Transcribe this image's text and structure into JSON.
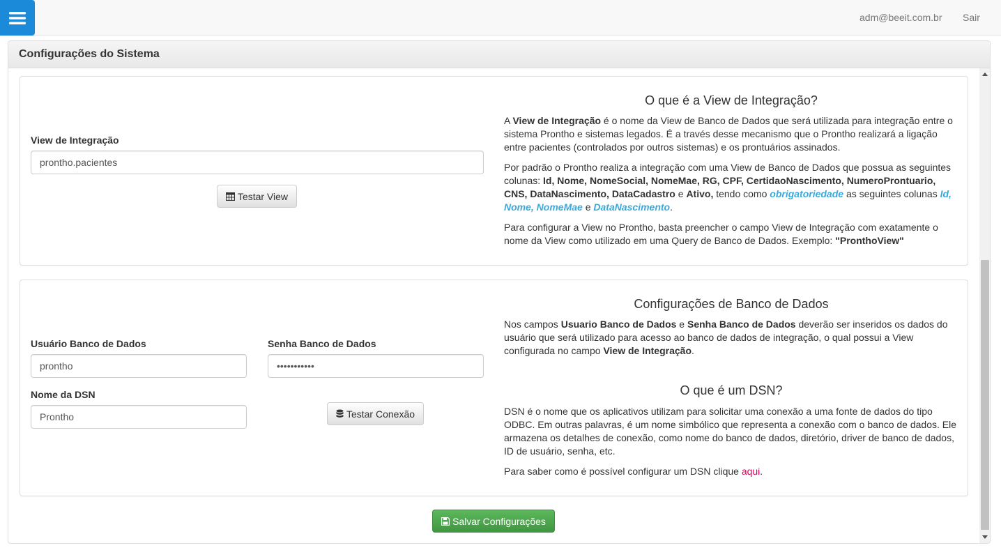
{
  "header": {
    "user_email": "adm@beeit.com.br",
    "logout_label": "Sair",
    "menu_icon": "hamburger-menu-icon"
  },
  "panel": {
    "title": "Configurações do Sistema"
  },
  "view_section": {
    "field_label": "View de Integração",
    "field_value": "prontho.pacientes",
    "test_button_label": "Testar View",
    "test_button_icon": "table-icon",
    "info_title": "O que é a View de Integração?",
    "para1": {
      "t1": "A ",
      "b1": "View de Integração",
      "t2": " é o nome da View de Banco de Dados que será utilizada para integração entre o sistema Prontho e sistemas legados. É a través desse mecanismo que o Prontho realizará a ligação entre pacientes (controlados por outros sistemas) e os prontuários assinados."
    },
    "para2": {
      "t1": "Por padrão o Prontho realiza a integração com uma View de Banco de Dados que possua as seguintes colunas: ",
      "b1": "Id, Nome, NomeSocial, NomeMae, RG, CPF, CertidaoNascimento, NumeroProntuario, CNS, DataNascimento, DataCadastro",
      "t2": " e ",
      "b2": "Ativo,",
      "t3": " tendo como ",
      "h1": "obrigatoriedade",
      "t4": " as seguintes colunas ",
      "h2": "Id, Nome, NomeMae",
      "t5": " e ",
      "h3": "DataNascimento",
      "t6": "."
    },
    "para3": {
      "t1": "Para configurar a View no Prontho, basta preencher o campo View de Integração com exatamente o nome da View como utilizado em uma Query de Banco de Dados. Exemplo: ",
      "b1": "\"PronthoView\""
    }
  },
  "db_section": {
    "user_label": "Usuário Banco de Dados",
    "user_value": "prontho",
    "password_label": "Senha Banco de Dados",
    "password_value": "•••••••••••",
    "dsn_label": "Nome da DSN",
    "dsn_value": "Prontho",
    "test_button_label": "Testar Conexão",
    "test_button_icon": "database-icon",
    "info_title": "Configurações de Banco de Dados",
    "para1": {
      "t1": "Nos campos ",
      "b1": "Usuario Banco de Dados",
      "t2": " e ",
      "b2": "Senha Banco de Dados",
      "t3": " deverão ser inseridos os dados do usuário que será utilizado para acesso ao banco de dados de integração, o qual possui a View configurada no campo ",
      "b3": "View de Integração",
      "t4": "."
    },
    "dsn_title": "O que é um DSN?",
    "dsn_para1": "DSN é o nome que os aplicativos utilizam para solicitar uma conexão a uma fonte de dados do tipo ODBC. Em outras palavras, é um nome simbólico que representa a conexão com o banco de dados. Ele armazena os detalhes de conexão, como nome do banco de dados, diretório, driver de banco de dados, ID de usuário, senha, etc.",
    "dsn_para2": {
      "t1": "Para saber como é possível configurar um DSN clique ",
      "link": "aqui",
      "t2": "."
    }
  },
  "footer": {
    "save_button_label": "Salvar Configurações",
    "save_button_icon": "floppy-disk-icon"
  },
  "colors": {
    "menu_button": "#1b8ad9",
    "success": "#5cb85c",
    "highlight": "#39a9db",
    "link": "#d9005b"
  }
}
